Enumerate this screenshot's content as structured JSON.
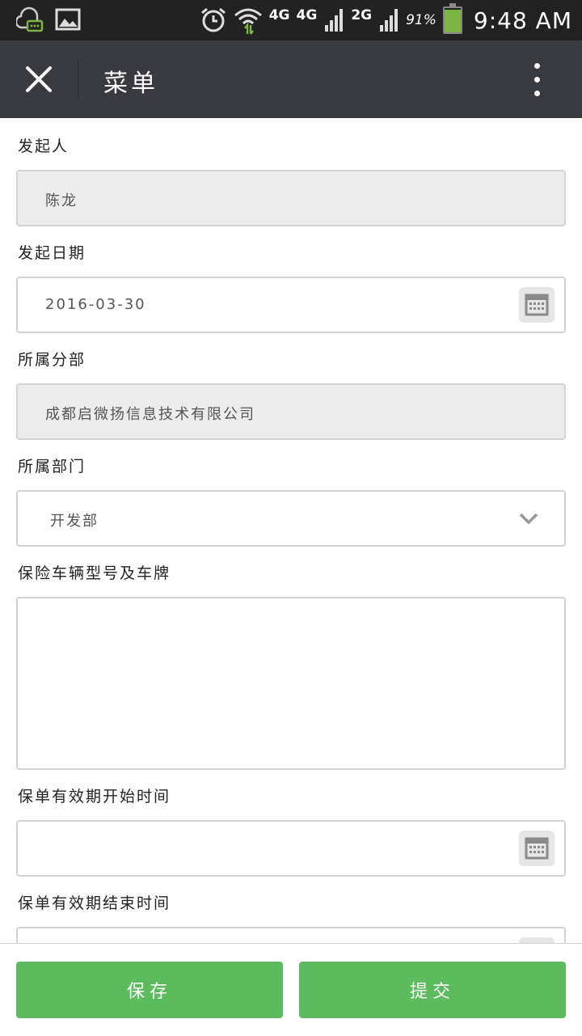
{
  "status_bar": {
    "net1": "4G",
    "net2": "4G",
    "net3": "2G",
    "battery_pct": "91%",
    "time": "9:48 AM",
    "icons": [
      "notification-bubble-icon",
      "image-icon",
      "alarm-icon",
      "wifi-icon",
      "signal-icon",
      "battery-icon"
    ]
  },
  "header": {
    "title": "菜单"
  },
  "form": {
    "initiator_label": "发起人",
    "initiator_value": "陈龙",
    "date_label": "发起日期",
    "date_value": "2016-03-30",
    "branch_label": "所属分部",
    "branch_value": "成都启微扬信息技术有限公司",
    "dept_label": "所属部门",
    "dept_value": "开发部",
    "vehicle_label": "保险车辆型号及车牌",
    "vehicle_value": "",
    "start_label": "保单有效期开始时间",
    "start_value": "",
    "end_label": "保单有效期结束时间",
    "end_value": ""
  },
  "actions": {
    "save": "保存",
    "submit": "提交"
  },
  "colors": {
    "title_bar": "#393a3f",
    "status_bar": "#222222",
    "button_green": "#5cbb5c",
    "readonly_bg": "#ececec"
  }
}
